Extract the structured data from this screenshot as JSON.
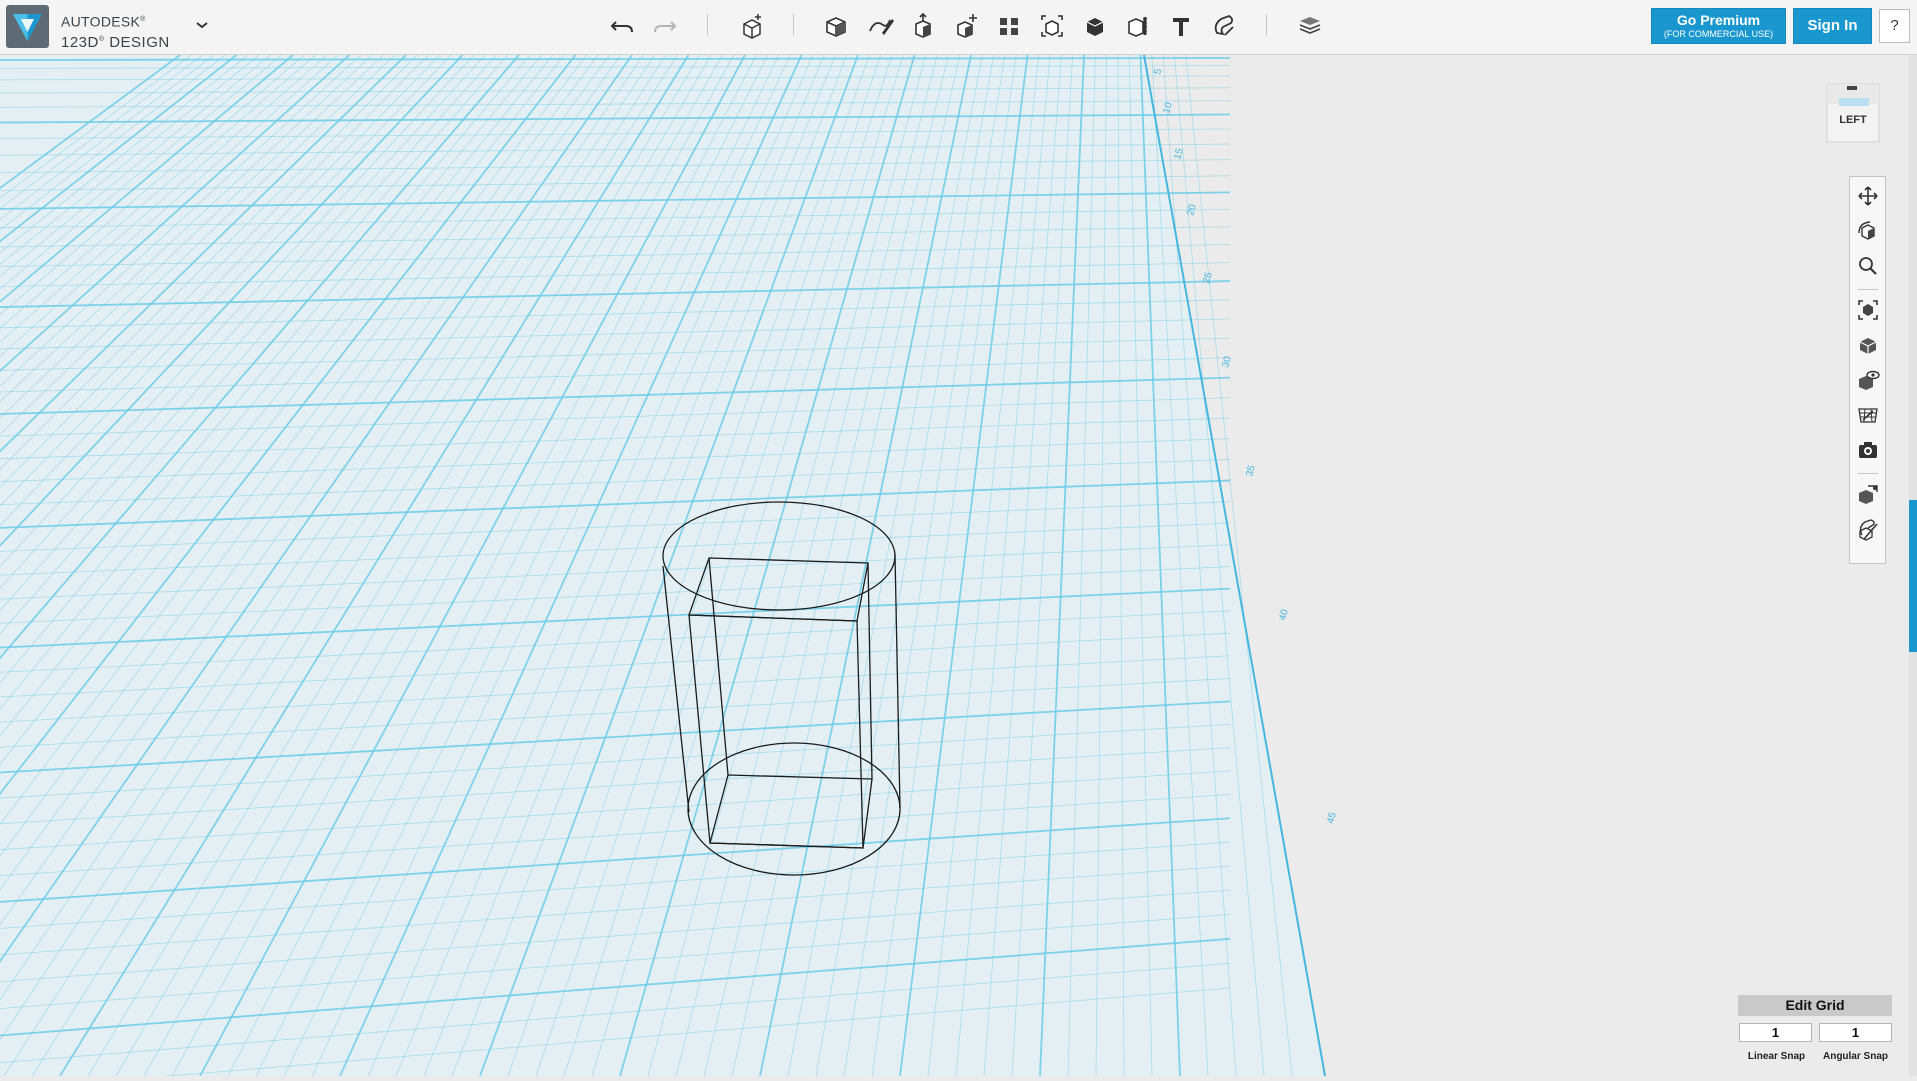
{
  "app": {
    "brand_line1": "AUTODESK",
    "brand_line1_mark": "®",
    "brand_line2": "123D",
    "brand_line2_mark": "®",
    "brand_line3": "DESIGN"
  },
  "header": {
    "premium_label": "Go Premium",
    "premium_sub": "(FOR COMMERCIAL USE)",
    "signin_label": "Sign In",
    "help_label": "?"
  },
  "toolbar_icons": [
    "undo-icon",
    "redo-icon",
    "transform-icon",
    "primitives-icon",
    "sketch-icon",
    "construct-icon",
    "modify-icon",
    "pattern-icon",
    "group-icon",
    "combine-icon",
    "measure-icon",
    "text-icon",
    "snap-icon",
    "material-icon"
  ],
  "viewcube": {
    "face_label": "LEFT"
  },
  "ruler_labels": [
    "5",
    "10",
    "15",
    "20",
    "25",
    "30",
    "35",
    "40",
    "45"
  ],
  "grid_panel": {
    "title": "Edit Grid",
    "linear_value": "1",
    "angular_value": "1",
    "linear_label": "Linear Snap",
    "angular_label": "Angular Snap"
  },
  "colors": {
    "accent": "#1a97cf",
    "grid_bg": "#e3eff3",
    "grid_line": "#6ccbe8"
  }
}
